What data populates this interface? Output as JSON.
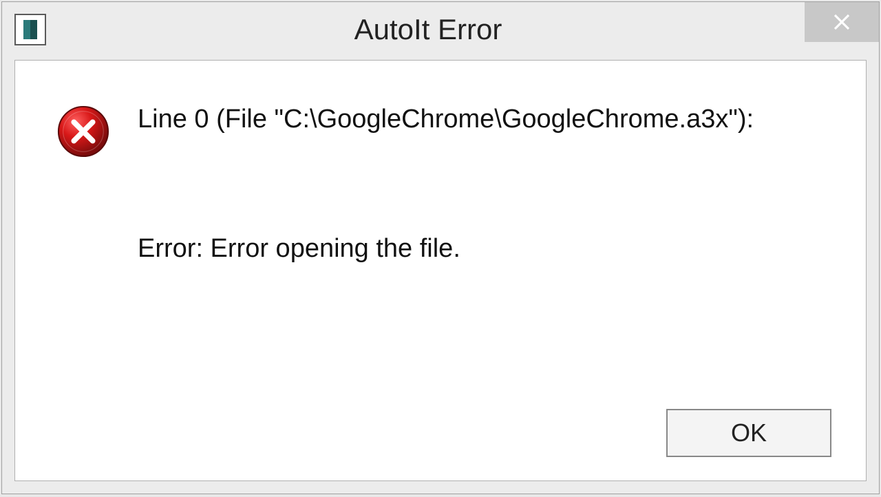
{
  "titlebar": {
    "title": "AutoIt Error"
  },
  "message": {
    "line1": "Line 0  (File \"C:\\GoogleChrome\\GoogleChrome.a3x\"):",
    "error_label": "Error: Error opening the file."
  },
  "buttons": {
    "ok_label": "OK"
  }
}
